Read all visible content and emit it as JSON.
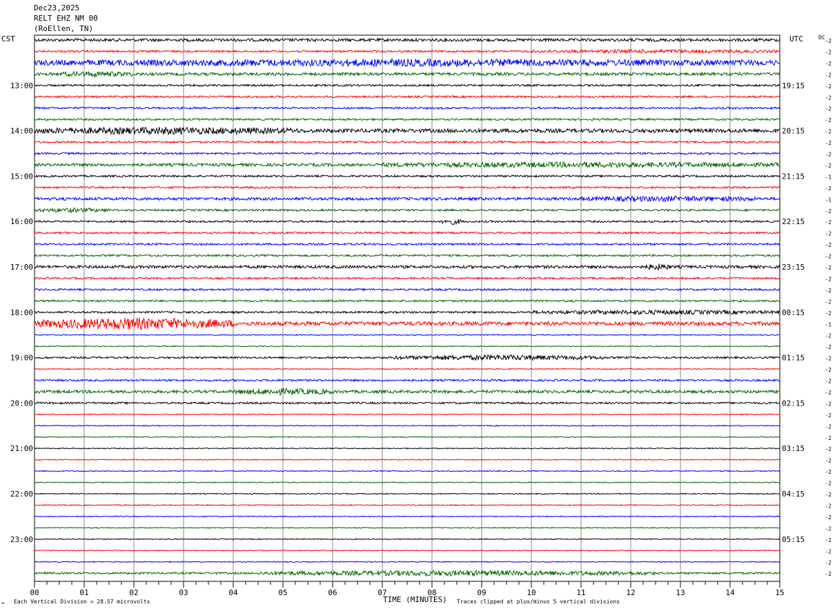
{
  "header": {
    "date": "Dec23,2025",
    "station": "RELT EHZ NM 00",
    "location": "(RoEllen, TN)"
  },
  "left_axis_label": "CST",
  "right_axis_label": "UTC",
  "dc_label": "DC",
  "x_axis_title": "TIME (MINUTES)",
  "footer": {
    "scale_note": "Each Vertical Division =   28.57 microvolts",
    "clip_note": "Traces clipped at plus/minus 5 vertical divisions"
  },
  "colors": {
    "trace_cycle": [
      "#000000",
      "#ff0000",
      "#0000ff",
      "#006400"
    ],
    "grid": "#888888",
    "frame": "#000000"
  },
  "chart_data": {
    "type": "line",
    "title": "",
    "xlabel": "TIME (MINUTES)",
    "ylabel": "",
    "xlim": [
      0,
      15
    ],
    "x_ticks": [
      "00",
      "01",
      "02",
      "03",
      "04",
      "05",
      "06",
      "07",
      "08",
      "09",
      "10",
      "11",
      "12",
      "13",
      "14",
      "15"
    ],
    "x_minor_ticks_per_minute": 4,
    "rows_per_hour": 4,
    "rows_count": 48,
    "left_time_labels": [
      "13:00",
      "14:00",
      "15:00",
      "16:00",
      "17:00",
      "18:00",
      "19:00",
      "20:00",
      "21:00",
      "22:00",
      "23:00"
    ],
    "right_time_labels": [
      "19:15",
      "20:15",
      "21:15",
      "22:15",
      "23:15",
      "00:15",
      "01:15",
      "02:15",
      "03:15",
      "04:15",
      "05:15"
    ],
    "label_first_row": 4,
    "dc_offsets": [
      -2,
      -2,
      -2,
      -2,
      -2,
      -2,
      -2,
      -2,
      -2,
      -2,
      -2,
      -2,
      -1,
      -2,
      -1,
      -2,
      -2,
      -2,
      -2,
      -2,
      -2,
      -2,
      -2,
      -2,
      -2,
      -1,
      -2,
      -2,
      -2,
      -2,
      -2,
      -2,
      -2,
      -2,
      -2,
      -2,
      -2,
      -2,
      -2,
      -2,
      -2,
      -2,
      -2,
      -2,
      -2,
      -2,
      -2,
      -2
    ],
    "vertical_division_microvolts": 28.57,
    "clip_divisions": 5,
    "grid": true,
    "trace_noise_level": [
      3,
      2,
      4,
      3,
      2,
      2,
      2,
      2,
      4,
      2,
      2,
      3,
      2,
      2,
      3,
      2,
      2,
      2,
      2,
      2,
      3,
      2,
      2,
      2,
      2,
      4,
      1,
      1,
      2,
      1,
      2,
      3,
      2,
      1,
      1,
      1,
      1,
      1,
      1,
      1,
      1,
      1,
      1,
      1,
      1,
      1,
      1,
      2
    ],
    "events": [
      {
        "row": 1,
        "start_min": 10.0,
        "end_min": 15.0,
        "amplitude": 2
      },
      {
        "row": 2,
        "start_min": 0.0,
        "end_min": 15.0,
        "amplitude": 4
      },
      {
        "row": 3,
        "start_min": 0.5,
        "end_min": 2.0,
        "amplitude": 3
      },
      {
        "row": 8,
        "start_min": 0.0,
        "end_min": 5.3,
        "amplitude": 4
      },
      {
        "row": 11,
        "start_min": 7.0,
        "end_min": 15.0,
        "amplitude": 3
      },
      {
        "row": 14,
        "start_min": 11.0,
        "end_min": 14.5,
        "amplitude": 3
      },
      {
        "row": 15,
        "start_min": 0.0,
        "end_min": 1.5,
        "amplitude": 3
      },
      {
        "row": 16,
        "start_min": 8.2,
        "end_min": 8.6,
        "amplitude": 5
      },
      {
        "row": 20,
        "start_min": 12.3,
        "end_min": 12.8,
        "amplitude": 4
      },
      {
        "row": 25,
        "start_min": 0.0,
        "end_min": 4.0,
        "amplitude": 9
      },
      {
        "row": 24,
        "start_min": 10.0,
        "end_min": 15.0,
        "amplitude": 3
      },
      {
        "row": 28,
        "start_min": 7.2,
        "end_min": 11.5,
        "amplitude": 4
      },
      {
        "row": 31,
        "start_min": 4.0,
        "end_min": 6.0,
        "amplitude": 4
      },
      {
        "row": 47,
        "start_min": 4.5,
        "end_min": 12.5,
        "amplitude": 4
      }
    ]
  }
}
